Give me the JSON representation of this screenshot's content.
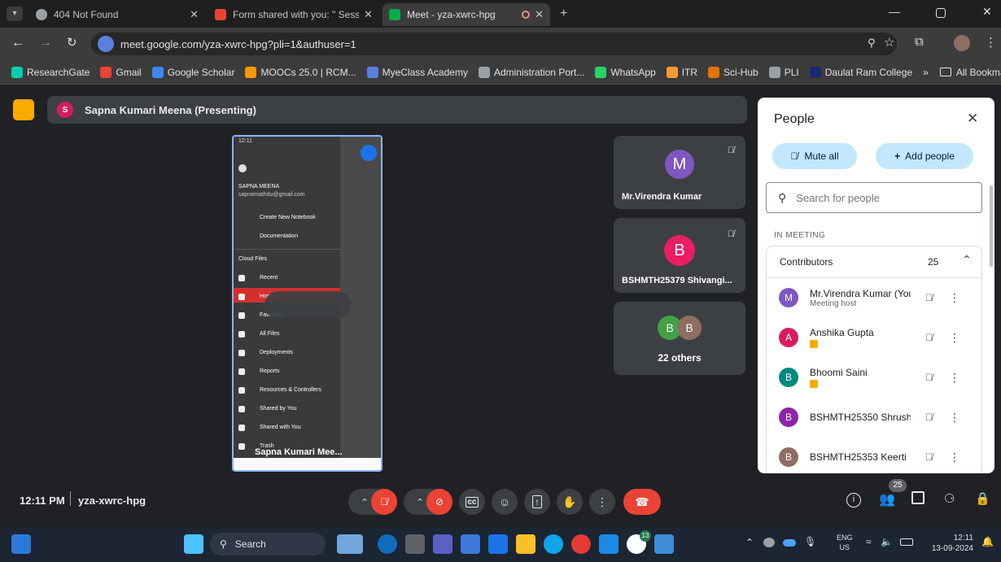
{
  "browser": {
    "tabs": [
      {
        "title": "404 Not Found"
      },
      {
        "title": "Form shared with you: \" Session"
      },
      {
        "title": "Meet - yza-xwrc-hpg"
      }
    ],
    "url": "meet.google.com/yza-xwrc-hpg?pli=1&authuser=1",
    "bookmarks": [
      {
        "label": "ResearchGate",
        "color": "#00d0af"
      },
      {
        "label": "Gmail",
        "color": "#ea4335"
      },
      {
        "label": "Google Scholar",
        "color": "#4285f4"
      },
      {
        "label": "MOOCs 25.0 | RCM...",
        "color": "#f29900"
      },
      {
        "label": "MyeClass Academy",
        "color": "#5b7fde"
      },
      {
        "label": "Administration Port...",
        "color": "#9aa0a6"
      },
      {
        "label": "WhatsApp",
        "color": "#25d366"
      },
      {
        "label": "ITR",
        "color": "#ff9933"
      },
      {
        "label": "Sci-Hub",
        "color": "#e37400"
      },
      {
        "label": "PLI",
        "color": "#9aa0a6"
      },
      {
        "label": "Daulat Ram College",
        "color": "#1a2a6c"
      }
    ],
    "bookmarks_more": "»",
    "all_bookmarks": "All Bookmarks"
  },
  "meet": {
    "presenter_initial": "S",
    "presenter_label": "Sapna Kumari Meena (Presenting)",
    "phone": {
      "time": "12:11",
      "user_name": "SAPNA MEENA",
      "user_email": "sapnamathdu@gmail.com",
      "menu": [
        "Create New Notebook",
        "Documentation"
      ],
      "section": "Cloud Files",
      "cloud_items": [
        "Recent",
        "Home",
        "Favorites",
        "All Files",
        "Deployments",
        "Reports",
        "Resources & Controllers",
        "Shared by You",
        "Shared with You",
        "Trash"
      ],
      "caption": "Sapna Kumari Mee..."
    },
    "tiles": [
      {
        "initial": "M",
        "name": "Mr.Virendra Kumar",
        "color": "#7e57c2"
      },
      {
        "initial": "B",
        "name": "BSHMTH25379 Shivangi...",
        "color": "#e91e63"
      }
    ],
    "others": {
      "avatars": [
        {
          "initial": "B",
          "color": "#43a047"
        },
        {
          "initial": "B",
          "color": "#8d6e63"
        }
      ],
      "label": "22 others"
    },
    "meeting_time": "12:11 PM",
    "meeting_code": "yza-xwrc-hpg",
    "participants_badge": "25"
  },
  "people": {
    "title": "People",
    "mute_all": "Mute all",
    "add_people": "Add people",
    "search_placeholder": "Search for people",
    "section": "IN MEETING",
    "group": {
      "label": "Contributors",
      "count": "25"
    },
    "list": [
      {
        "initial": "M",
        "name": "Mr.Virendra Kumar (You)",
        "sub": "Meeting host",
        "color": "#7e57c2"
      },
      {
        "initial": "A",
        "name": "Anshika Gupta",
        "sub": "",
        "color": "#d81b60"
      },
      {
        "initial": "B",
        "name": "Bhoomi Saini",
        "sub": "",
        "color": "#00897b"
      },
      {
        "initial": "B",
        "name": "BSHMTH25350 Shrushti...",
        "sub": "",
        "color": "#8e24aa"
      },
      {
        "initial": "B",
        "name": "BSHMTH25353 Keerti",
        "sub": "",
        "color": "#8d6e63"
      }
    ]
  },
  "taskbar": {
    "search": "Search",
    "lang_top": "ENG",
    "lang_bottom": "US",
    "clock_time": "12:11",
    "clock_date": "13-09-2024",
    "badge": "13"
  }
}
